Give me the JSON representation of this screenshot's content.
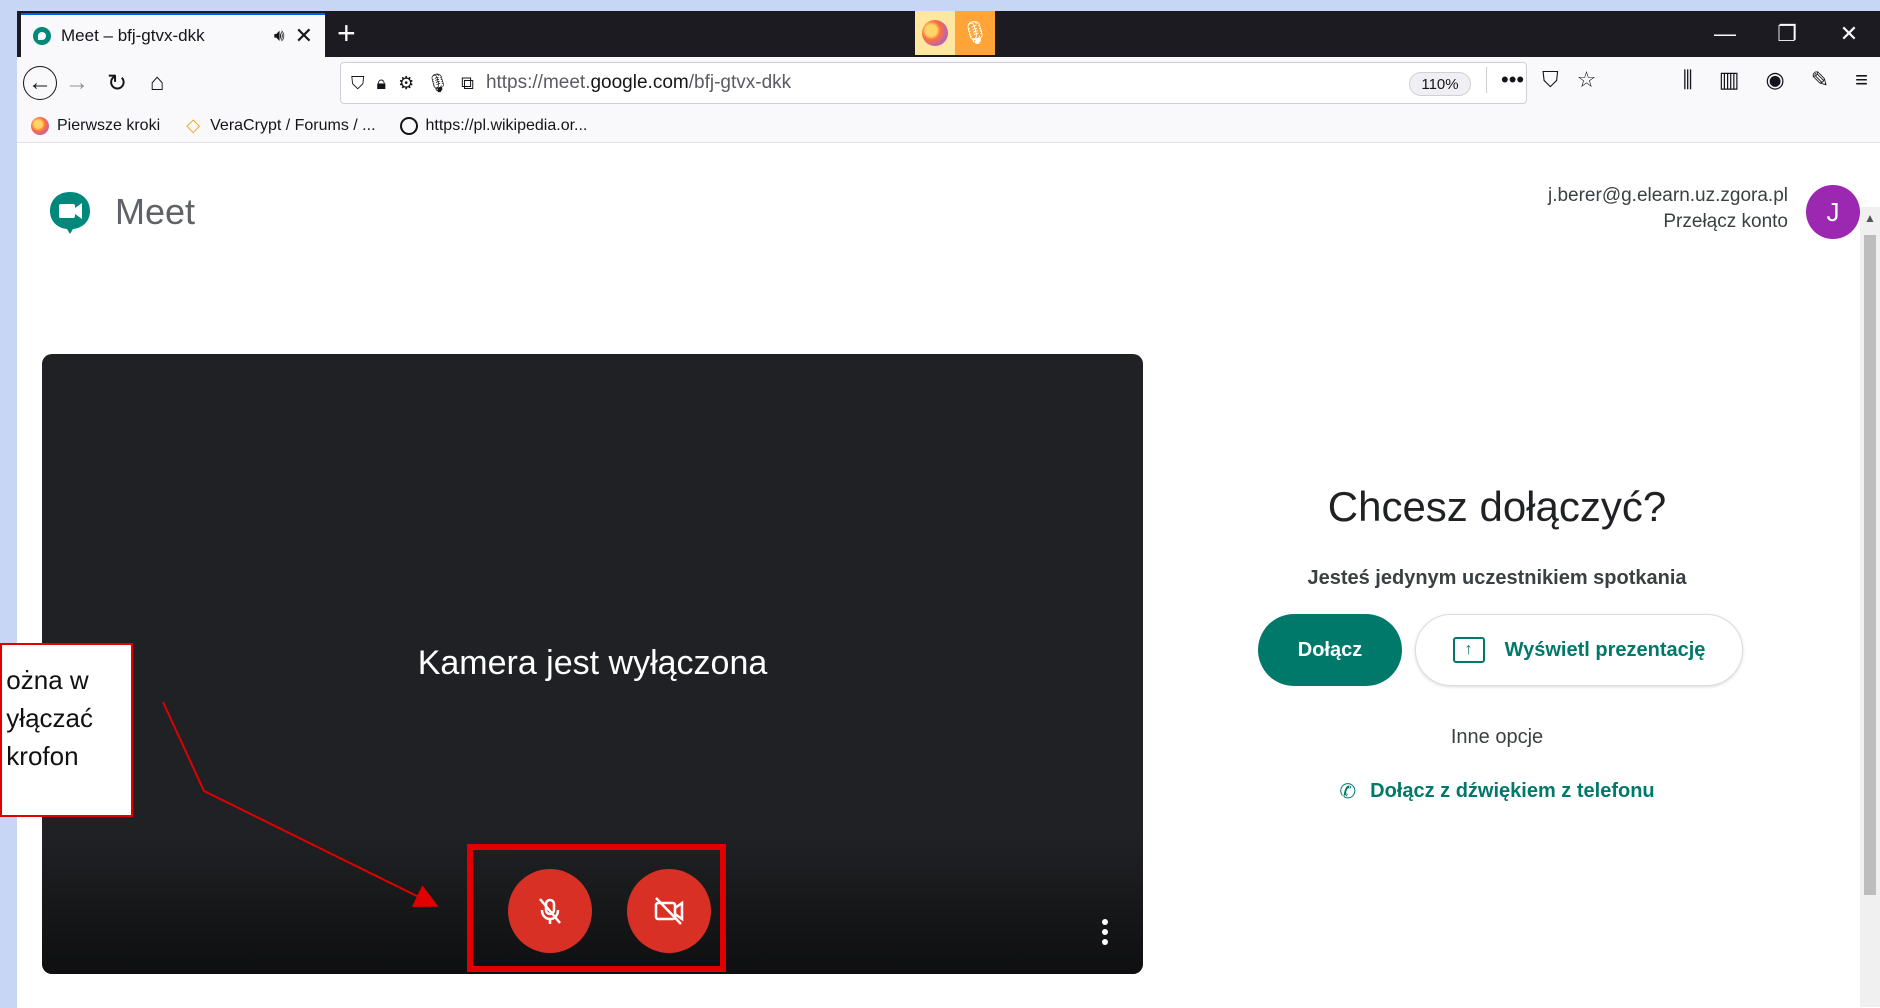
{
  "browser": {
    "tab": {
      "title": "Meet – bfj-gtvx-dkk",
      "sound_icon": "speaker-icon",
      "close": "✕"
    },
    "new_tab": "+",
    "indicators": [
      "firefox-icon",
      "microphone-icon"
    ],
    "window_controls": [
      "—",
      "❐",
      "✕"
    ],
    "url": {
      "prefix": "https://meet.",
      "domain": "google.com",
      "suffix": "/bfj-gtvx-dkk"
    },
    "zoom": "110%",
    "page_actions": [
      "•••",
      "pocket-icon",
      "star-icon"
    ],
    "toolbar_right": [
      "library-icon",
      "sidebar-icon",
      "account-icon",
      "eyedropper-icon",
      "menu-icon"
    ],
    "bookmarks": [
      {
        "label": "Pierwsze kroki",
        "icon": "firefox-icon"
      },
      {
        "label": "VeraCrypt / Forums / ...",
        "icon": "veracrypt-icon"
      },
      {
        "label": "https://pl.wikipedia.or...",
        "icon": "globe-icon"
      }
    ]
  },
  "meet": {
    "logo_text": "Meet",
    "account": {
      "email": "j.berer@g.elearn.uz.zgora.pl",
      "switch_label": "Przełącz konto",
      "avatar_letter": "J"
    },
    "preview": {
      "camera_off_text": "Kamera jest wyłączona"
    },
    "join": {
      "heading": "Chcesz dołączyć?",
      "subheading": "Jesteś jedynym uczestnikiem spotkania",
      "join_button": "Dołącz",
      "present_button": "Wyświetl prezentację",
      "other_options": "Inne opcje",
      "phone_audio": "Dołącz z dźwiękiem z telefonu"
    }
  },
  "annotation": {
    "callout_text": "ożna w\nyłączać\nkrofon",
    "border_color": "#e00000"
  },
  "colors": {
    "meet_green": "#00796b",
    "mic_cam_off": "#d93025",
    "avatar": "#9c27b0"
  }
}
